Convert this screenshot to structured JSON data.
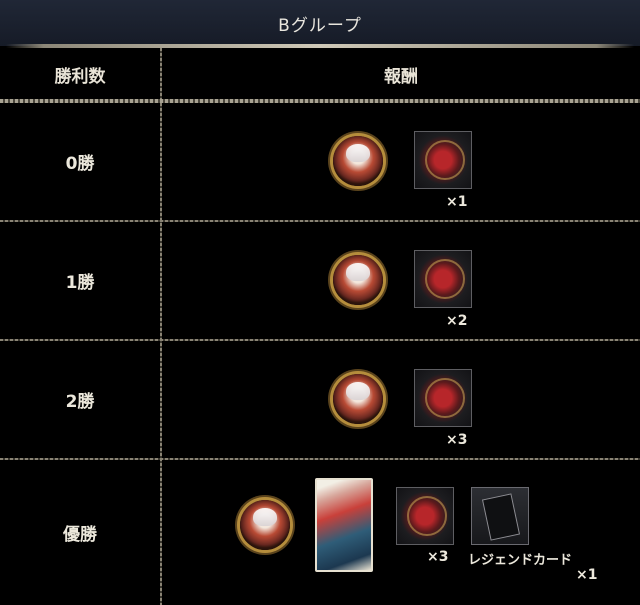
{
  "title": "Bグループ",
  "table": {
    "header_wins": "勝利数",
    "header_rewards": "報酬",
    "rows": [
      {
        "wins": "0勝",
        "qty": "×1"
      },
      {
        "wins": "1勝",
        "qty": "×2"
      },
      {
        "wins": "2勝",
        "qty": "×3"
      },
      {
        "wins": "優勝",
        "qty": "×3",
        "card_name": "レジェンドカード",
        "card_qty": "×1"
      }
    ]
  }
}
